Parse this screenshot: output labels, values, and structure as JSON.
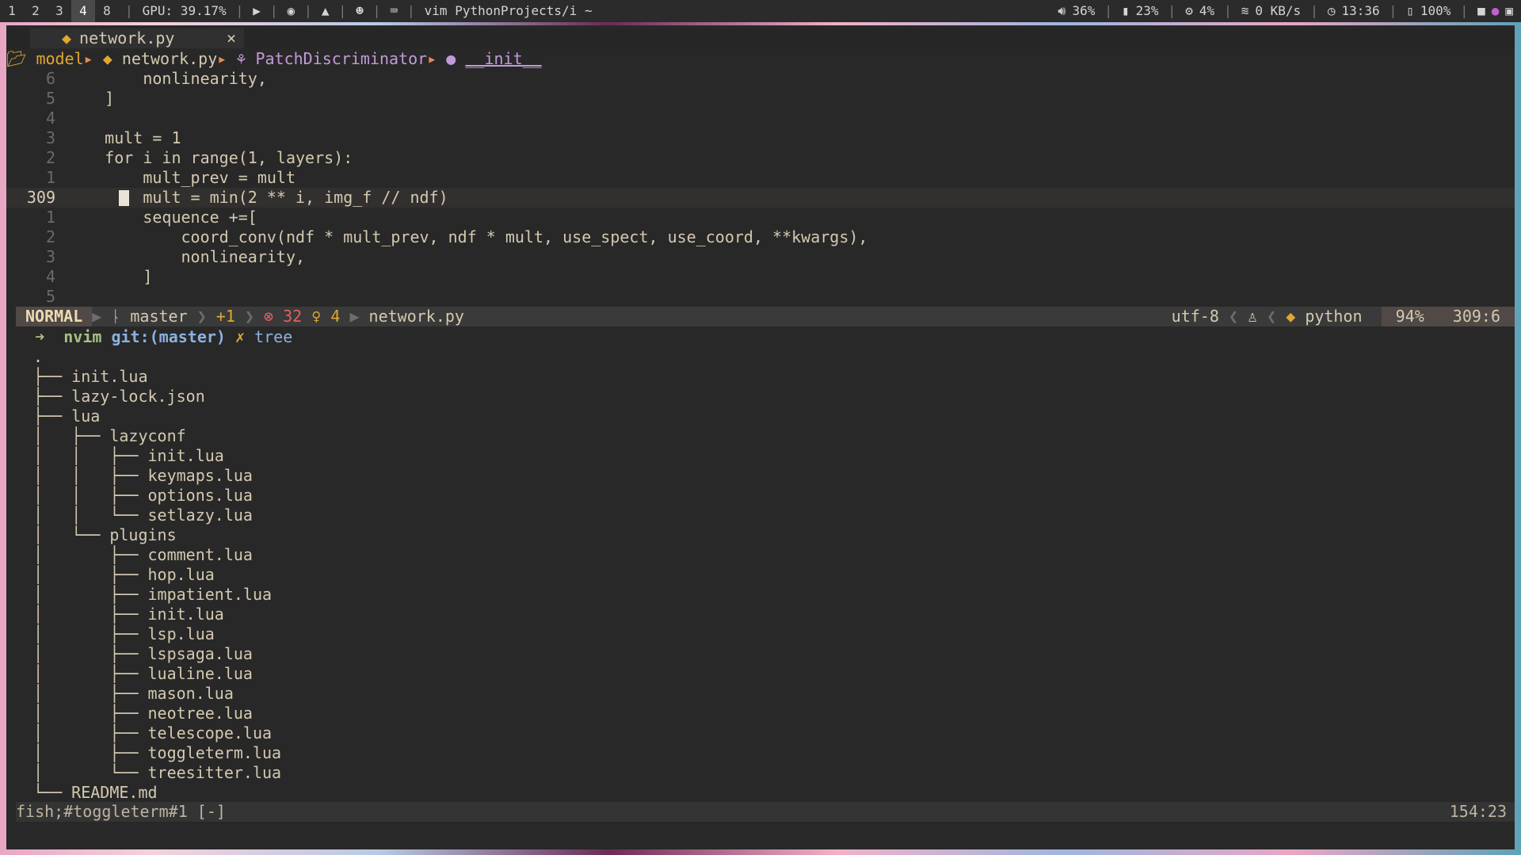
{
  "topbar": {
    "workspaces": [
      "1",
      "2",
      "3",
      "4",
      "8"
    ],
    "active_workspace": "4",
    "gpu": "GPU: 39.17%",
    "window_title": "vim PythonProjects/i ~",
    "volume": "36%",
    "memory": "23%",
    "cpu": "4%",
    "network": "0 KB/s",
    "clock": "13:36",
    "battery": "100%"
  },
  "editor": {
    "tab_name": "network.py",
    "tab_close": "×",
    "breadcrumb": {
      "folder": "model",
      "file": "network.py",
      "class": "PatchDiscriminator",
      "method": "__init__"
    },
    "lines": [
      {
        "num": "6",
        "text": "        nonlinearity,"
      },
      {
        "num": "5",
        "text": "    ]"
      },
      {
        "num": "4",
        "text": ""
      },
      {
        "num": "3",
        "text": "    mult = 1"
      },
      {
        "num": "2",
        "text": "    for i in range(1, layers):"
      },
      {
        "num": "1",
        "text": "        mult_prev = mult"
      },
      {
        "num": "309",
        "text": "        mult = min(2 ** i, img_f // ndf)",
        "current": true
      },
      {
        "num": "1",
        "text": "        sequence +=["
      },
      {
        "num": "2",
        "text": "            coord_conv(ndf * mult_prev, ndf * mult, use_spect, use_coord, **kwargs),"
      },
      {
        "num": "3",
        "text": "            nonlinearity,"
      },
      {
        "num": "4",
        "text": "        ]"
      },
      {
        "num": "5",
        "text": ""
      }
    ]
  },
  "statusline": {
    "mode": "NORMAL",
    "branch": "master",
    "diff": "+1",
    "errors": "32",
    "hints": "4",
    "filename": "network.py",
    "encoding": "utf-8",
    "filetype": "python",
    "progress": "94%",
    "position": "309:6"
  },
  "terminal": {
    "prompt_arrow": "➜",
    "prompt_dir": "nvim",
    "prompt_git": "git:(master)",
    "prompt_x": "✗",
    "command": "tree",
    "tree": [
      ".",
      "├── init.lua",
      "├── lazy-lock.json",
      "├── lua",
      "│   ├── lazyconf",
      "│   │   ├── init.lua",
      "│   │   ├── keymaps.lua",
      "│   │   ├── options.lua",
      "│   │   └── setlazy.lua",
      "│   └── plugins",
      "│       ├── comment.lua",
      "│       ├── hop.lua",
      "│       ├── impatient.lua",
      "│       ├── init.lua",
      "│       ├── lsp.lua",
      "│       ├── lspsaga.lua",
      "│       ├── lualine.lua",
      "│       ├── mason.lua",
      "│       ├── neotree.lua",
      "│       ├── telescope.lua",
      "│       ├── toggleterm.lua",
      "│       └── treesitter.lua",
      "└── README.md"
    ],
    "status_name": "fish;#toggleterm#1 [-]",
    "status_pos": "154:23"
  }
}
